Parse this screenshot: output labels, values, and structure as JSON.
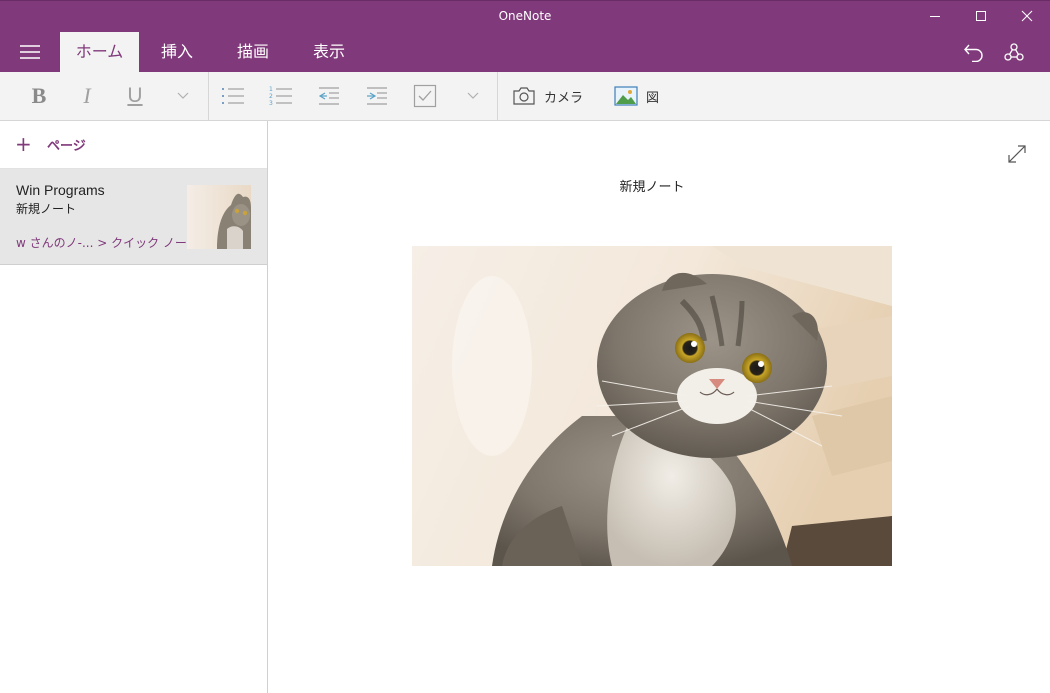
{
  "window": {
    "title": "OneNote"
  },
  "tabs": [
    {
      "label": "ホーム",
      "active": true
    },
    {
      "label": "挿入",
      "active": false
    },
    {
      "label": "描画",
      "active": false
    },
    {
      "label": "表示",
      "active": false
    }
  ],
  "toolbar": {
    "bold": "B",
    "italic": "I",
    "underline": "U",
    "camera_label": "カメラ",
    "picture_label": "図"
  },
  "sidebar": {
    "add_page_label": "ページ",
    "pages": [
      {
        "title": "Win Programs",
        "subtitle": "新規ノート",
        "path": "w さんのノ-... > クイック ノート",
        "selected": true
      }
    ]
  },
  "note": {
    "title": "新規ノート"
  },
  "colors": {
    "accent": "#80397b",
    "ribbon_bg": "#f3f3f3",
    "selected_page": "#e6e6e6"
  }
}
